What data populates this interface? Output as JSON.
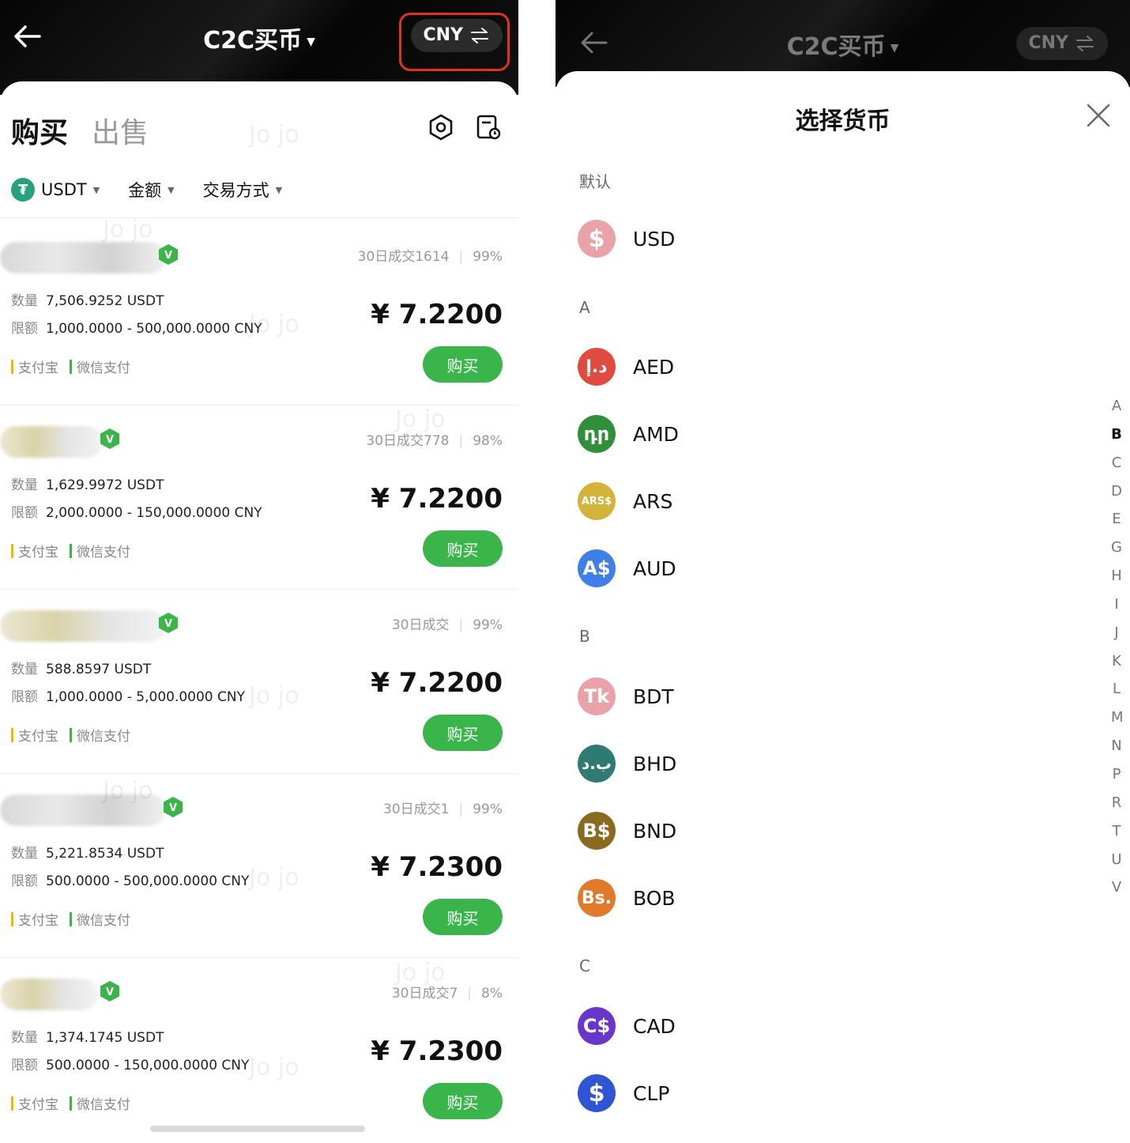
{
  "left": {
    "header": {
      "title": "C2C买币",
      "currency": "CNY"
    },
    "tabs": [
      "购买",
      "出售"
    ],
    "filters": {
      "coin": "USDT",
      "coin_logo": "₮",
      "amount": "金额",
      "payment": "交易方式"
    },
    "listings": [
      {
        "stats_count": "30日成交1614",
        "stats_rate": "99%",
        "quantity_label": "数量",
        "quantity": "7,506.9252 USDT",
        "limit_label": "限额",
        "limit": "1,000.0000 - 500,000.0000 CNY",
        "price": "¥ 7.2200",
        "pay1": "支付宝",
        "pay2": "微信支付",
        "buy": "购买"
      },
      {
        "stats_count": "30日成交778",
        "stats_rate": "98%",
        "quantity_label": "数量",
        "quantity": "1,629.9972 USDT",
        "limit_label": "限额",
        "limit": "2,000.0000 - 150,000.0000 CNY",
        "price": "¥ 7.2200",
        "pay1": "支付宝",
        "pay2": "微信支付",
        "buy": "购买"
      },
      {
        "stats_count": "30日成交",
        "stats_rate": "99%",
        "quantity_label": "数量",
        "quantity": "588.8597 USDT",
        "limit_label": "限额",
        "limit": "1,000.0000 - 5,000.0000 CNY",
        "price": "¥ 7.2200",
        "pay1": "支付宝",
        "pay2": "微信支付",
        "buy": "购买"
      },
      {
        "stats_count": "30日成交1",
        "stats_rate": "99%",
        "quantity_label": "数量",
        "quantity": "5,221.8534 USDT",
        "limit_label": "限额",
        "limit": "500.0000 - 500,000.0000 CNY",
        "price": "¥ 7.2300",
        "pay1": "支付宝",
        "pay2": "微信支付",
        "buy": "购买"
      },
      {
        "stats_count": "30日成交7",
        "stats_rate": "8%",
        "quantity_label": "数量",
        "quantity": "1,374.1745 USDT",
        "limit_label": "限额",
        "limit": "500.0000 - 150,000.0000 CNY",
        "price": "¥ 7.2300",
        "pay1": "支付宝",
        "pay2": "微信支付",
        "buy": "购买"
      }
    ],
    "watermark": "Jo jo"
  },
  "right": {
    "header": {
      "title": "C2C买币",
      "currency": "CNY"
    },
    "sheet_title": "选择货币",
    "sections": [
      {
        "label": "默认",
        "items": [
          {
            "code": "USD",
            "symbol": "$",
            "color": "#e9a3a8"
          }
        ]
      },
      {
        "label": "A",
        "items": [
          {
            "code": "AED",
            "symbol": "د.إ",
            "color": "#e04a3f"
          },
          {
            "code": "AMD",
            "symbol": "դր",
            "color": "#2f8f3a"
          },
          {
            "code": "ARS",
            "symbol": "ARS$",
            "color": "#d3b33a"
          },
          {
            "code": "AUD",
            "symbol": "A$",
            "color": "#3f7fe8"
          }
        ]
      },
      {
        "label": "B",
        "items": [
          {
            "code": "BDT",
            "symbol": "Tk",
            "color": "#e9a3a8"
          },
          {
            "code": "BHD",
            "symbol": "ب.د",
            "color": "#2f7a72"
          },
          {
            "code": "BND",
            "symbol": "B$",
            "color": "#8a6a1f"
          },
          {
            "code": "BOB",
            "symbol": "Bs.",
            "color": "#e07b2a"
          }
        ]
      },
      {
        "label": "C",
        "items": [
          {
            "code": "CAD",
            "symbol": "C$",
            "color": "#6a35c9"
          },
          {
            "code": "CLP",
            "symbol": "$",
            "color": "#2f55d4"
          }
        ]
      }
    ],
    "alpha_index": [
      "A",
      "B",
      "C",
      "D",
      "E",
      "G",
      "H",
      "I",
      "J",
      "K",
      "L",
      "M",
      "N",
      "P",
      "R",
      "T",
      "U",
      "V"
    ],
    "alpha_active": "B"
  },
  "colors": {
    "accent_green": "#3ab54a",
    "highlight_red": "#e0321f",
    "alipay": "#f5b700",
    "wechat": "#3ab54a"
  }
}
